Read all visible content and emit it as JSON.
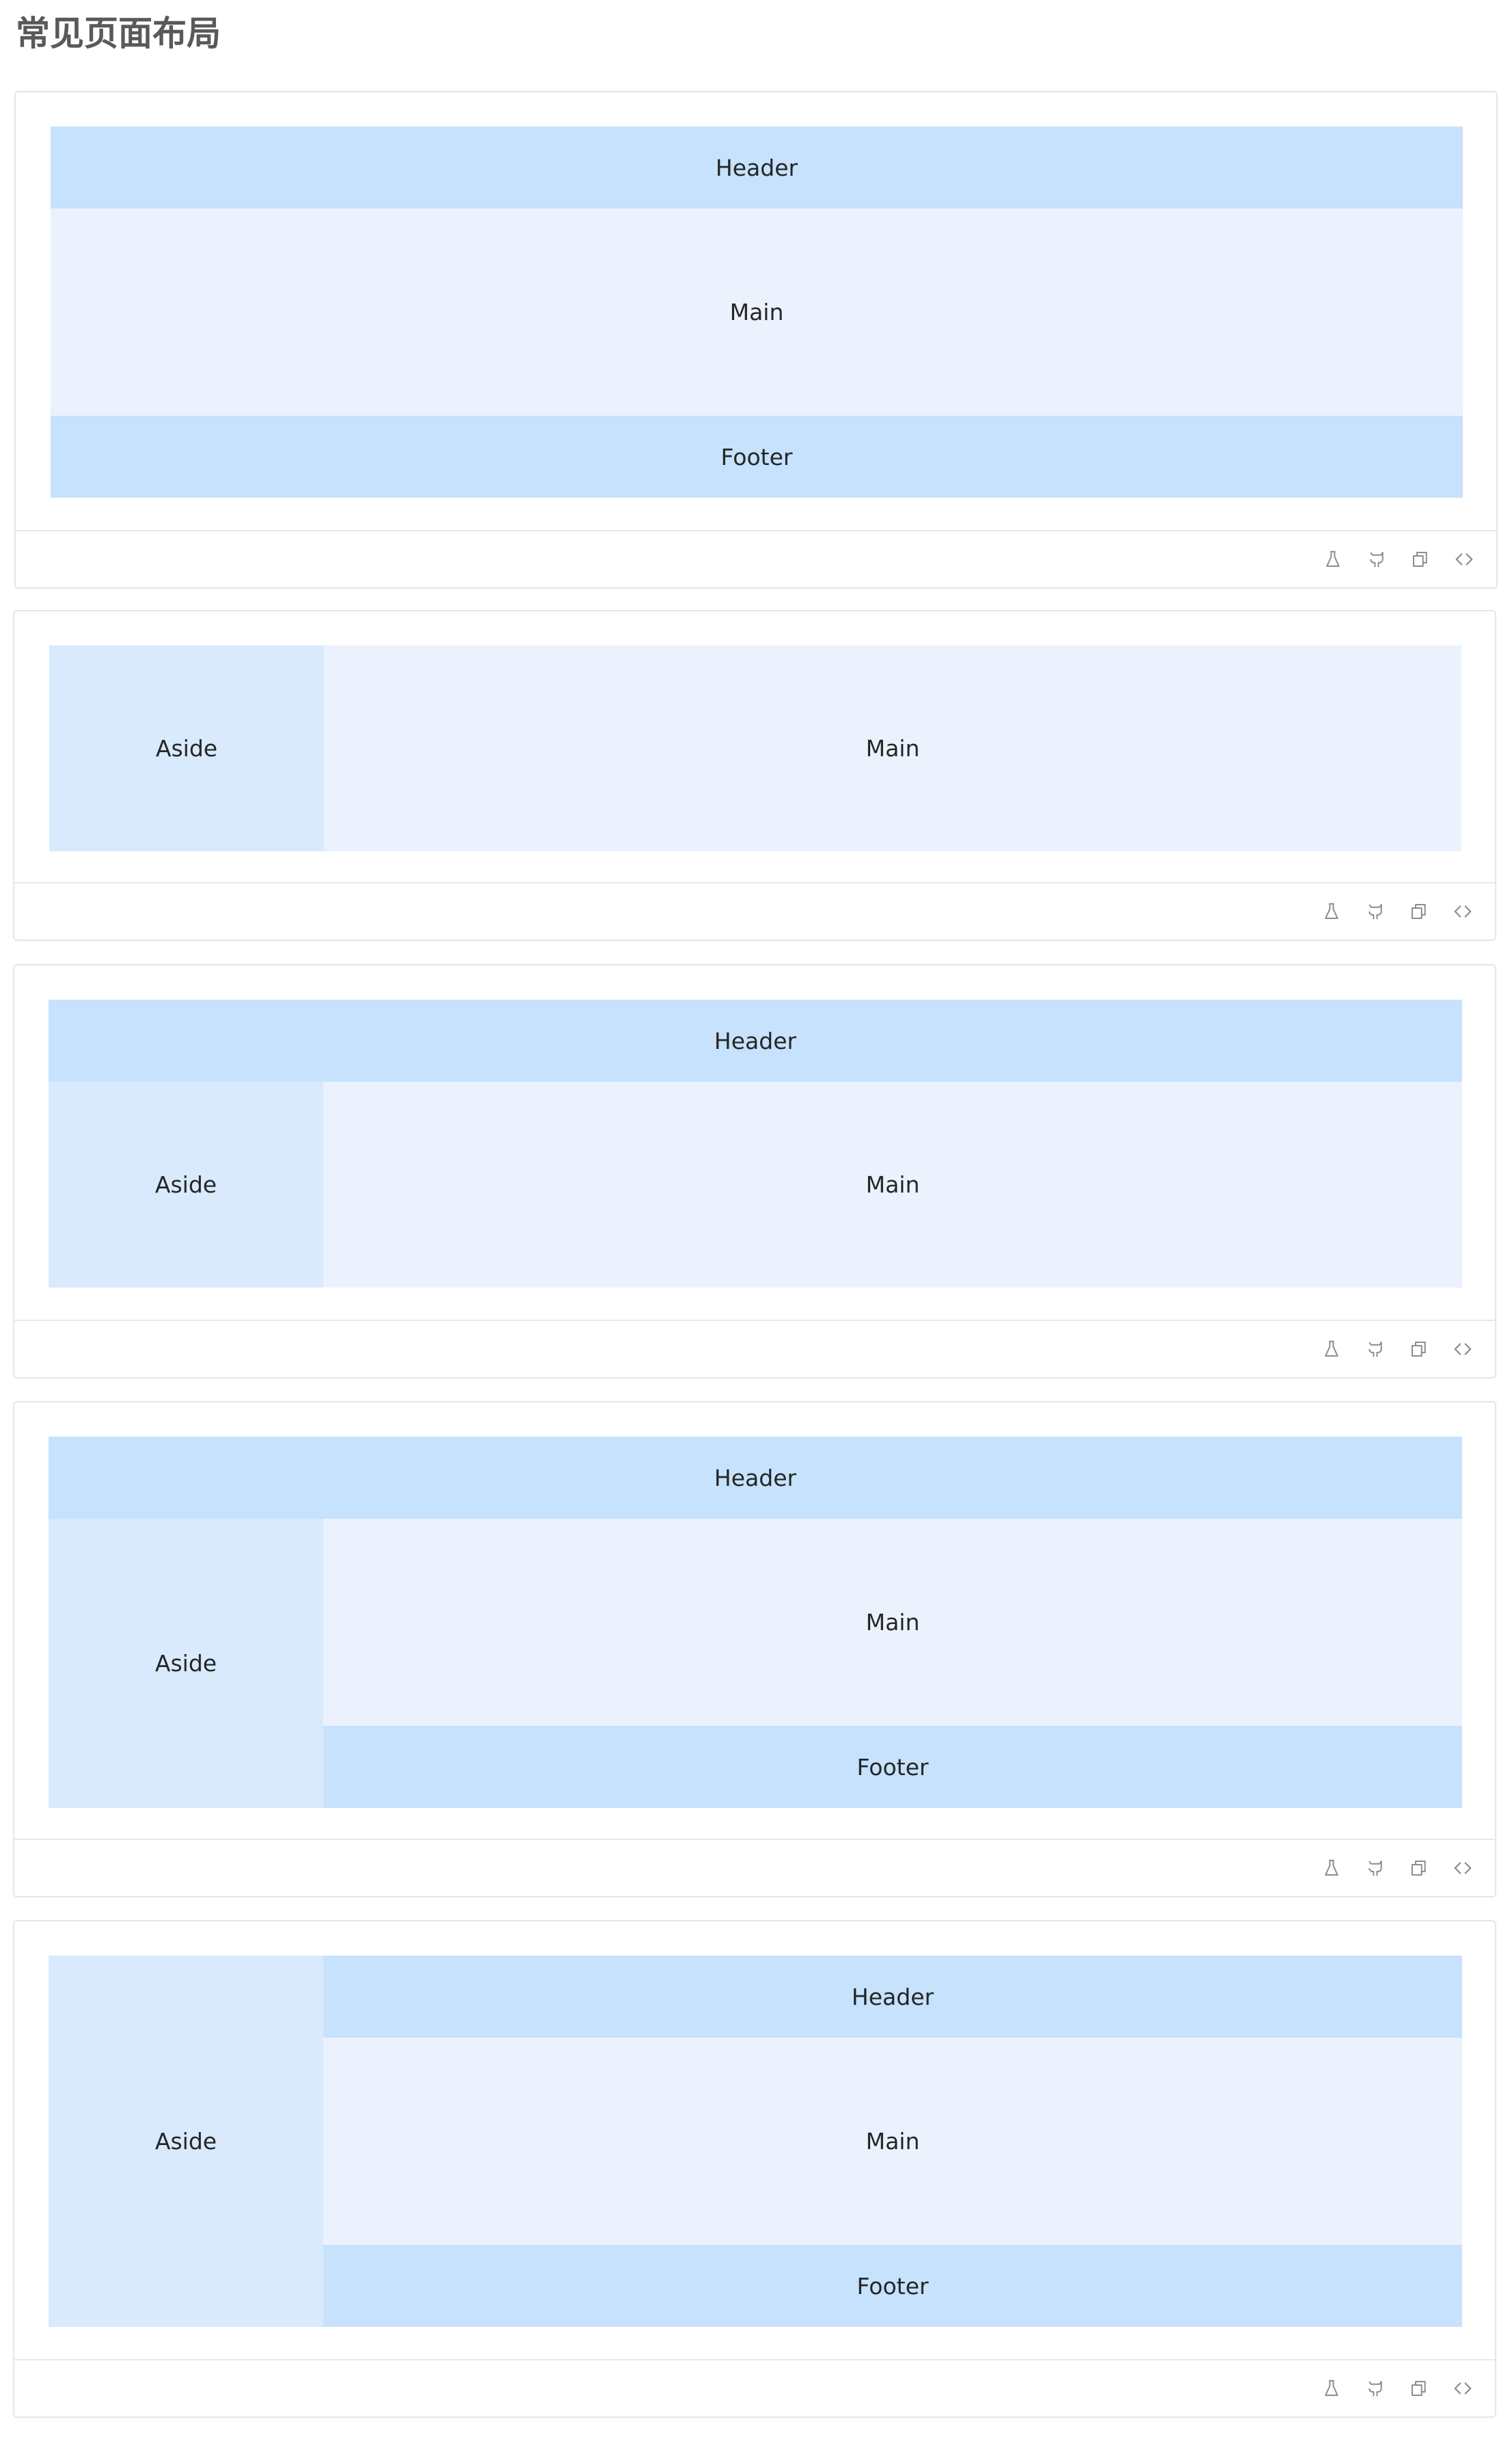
{
  "page": {
    "title": "常见页面布局"
  },
  "colors": {
    "header": "#c6e2fc",
    "footer": "#c6e2fc",
    "main": "#ebf2fe",
    "aside": "#d9eafd",
    "card_border": "#e4e6ea"
  },
  "demos": [
    {
      "regions": {
        "header": "Header",
        "main": "Main",
        "footer": "Footer"
      },
      "toolbar": [
        "flask-icon",
        "github-icon",
        "copy-icon",
        "code-icon"
      ]
    },
    {
      "regions": {
        "aside": "Aside",
        "main": "Main"
      },
      "toolbar": [
        "flask-icon",
        "github-icon",
        "copy-icon",
        "code-icon"
      ]
    },
    {
      "regions": {
        "header": "Header",
        "aside": "Aside",
        "main": "Main"
      },
      "toolbar": [
        "flask-icon",
        "github-icon",
        "copy-icon",
        "code-icon"
      ]
    },
    {
      "regions": {
        "header": "Header",
        "aside": "Aside",
        "main": "Main",
        "footer": "Footer"
      },
      "toolbar": [
        "flask-icon",
        "github-icon",
        "copy-icon",
        "code-icon"
      ]
    },
    {
      "regions": {
        "aside": "Aside",
        "header": "Header",
        "main": "Main",
        "footer": "Footer"
      },
      "toolbar": [
        "flask-icon",
        "github-icon",
        "copy-icon",
        "code-icon"
      ]
    }
  ]
}
